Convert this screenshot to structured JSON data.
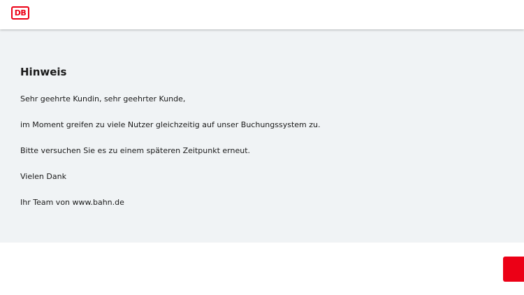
{
  "header": {
    "logo_text": "DB",
    "logo_color": "#ec0016"
  },
  "notice": {
    "title": "Hinweis",
    "paragraphs": [
      "Sehr geehrte Kundin, sehr geehrter Kunde,",
      "im Moment greifen zu viele Nutzer gleichzeitig auf unser Buchungssystem zu.",
      "Bitte versuchen Sie es zu einem späteren Zeitpunkt erneut.",
      "Vielen Dank",
      "Ihr Team von www.bahn.de"
    ],
    "background_color": "#f0f3f5"
  },
  "floating_button": {
    "color": "#ec0016"
  }
}
